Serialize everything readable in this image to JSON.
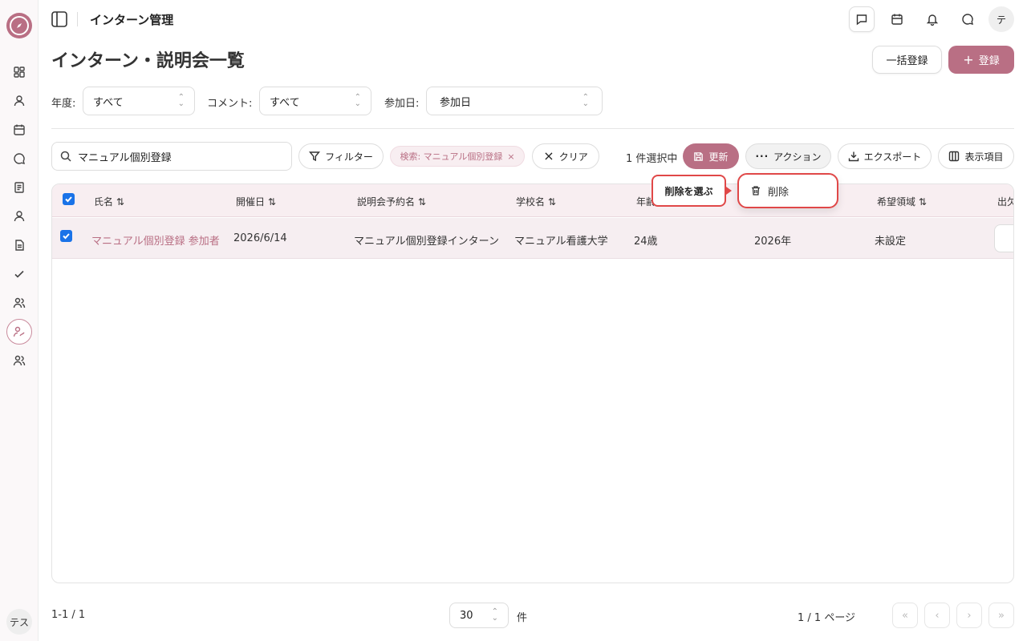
{
  "header": {
    "app_title": "インターン管理",
    "avatar": "テ"
  },
  "sidebar": {
    "user_avatar": "テス"
  },
  "page": {
    "title": "インターン・説明会一覧",
    "bulk_register": "一括登録",
    "register": "登録"
  },
  "filters": {
    "year_label": "年度:",
    "year_value": "すべて",
    "comment_label": "コメント:",
    "comment_value": "すべて",
    "date_label": "参加日:",
    "date_value": "参加日"
  },
  "toolbar": {
    "search_value": "マニュアル個別登録",
    "filter_label": "フィルター",
    "chip_label": "検索: マニュアル個別登録",
    "clear_label": "クリア",
    "selected_count": "1 件選択中",
    "update_label": "更新",
    "action_label": "アクション",
    "export_label": "エクスポート",
    "columns_label": "表示項目"
  },
  "table": {
    "columns": [
      "氏名 ⇅",
      "開催日 ⇅",
      "説明会予約名 ⇅",
      "学校名 ⇅",
      "年齢",
      "希望領域 ⇅",
      "出欠"
    ],
    "rows": [
      {
        "name": "マニュアル個別登録 参加者",
        "date": "2026/6/14",
        "event": "マニュアル個別登録インターン",
        "school": "マニュアル看護大学",
        "age": "24歳",
        "grad_year": "2026年",
        "area": "未設定"
      }
    ]
  },
  "action_menu": {
    "delete_label": "削除"
  },
  "tooltip": {
    "text": "削除を選ぶ"
  },
  "footer": {
    "range": "1-1 / 1",
    "page_size": "30",
    "unit": "件",
    "page_info": "1 / 1 ページ"
  },
  "colors": {
    "accent": "#b96f84",
    "highlight": "#e04848"
  }
}
